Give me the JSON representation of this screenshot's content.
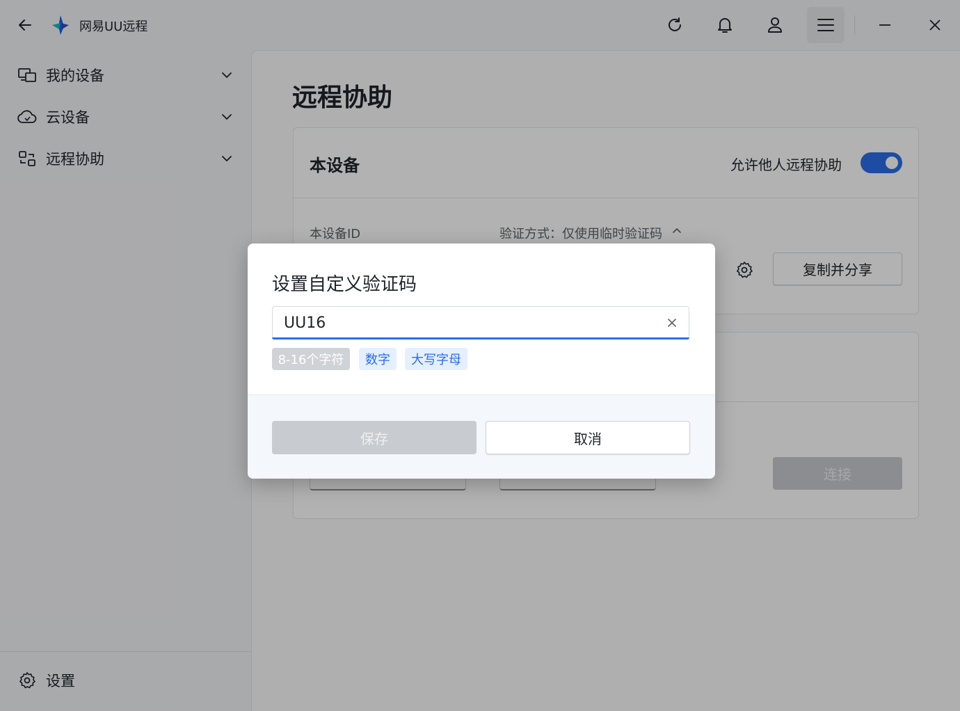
{
  "app": {
    "title": "网易UU远程"
  },
  "sidebar": {
    "items": [
      {
        "label": "我的设备"
      },
      {
        "label": "云设备"
      },
      {
        "label": "远程协助"
      }
    ],
    "settings_label": "设置"
  },
  "main": {
    "page_title": "远程协助",
    "this_device": {
      "title": "本设备",
      "allow_label": "允许他人远程协助",
      "allow_enabled": true,
      "device_id_label": "本设备ID",
      "verify_label": "验证方式：仅使用临时验证码",
      "copy_share_label": "复制并分享"
    },
    "connect_label": "连接"
  },
  "dialog": {
    "title": "设置自定义验证码",
    "input_value": "UU16",
    "tags": [
      "8-16个字符",
      "数字",
      "大写字母"
    ],
    "save_label": "保存",
    "cancel_label": "取消"
  },
  "colors": {
    "accent": "#2b6de8",
    "tag_bg": "#e4efff",
    "disabled": "#c8ccd0"
  }
}
